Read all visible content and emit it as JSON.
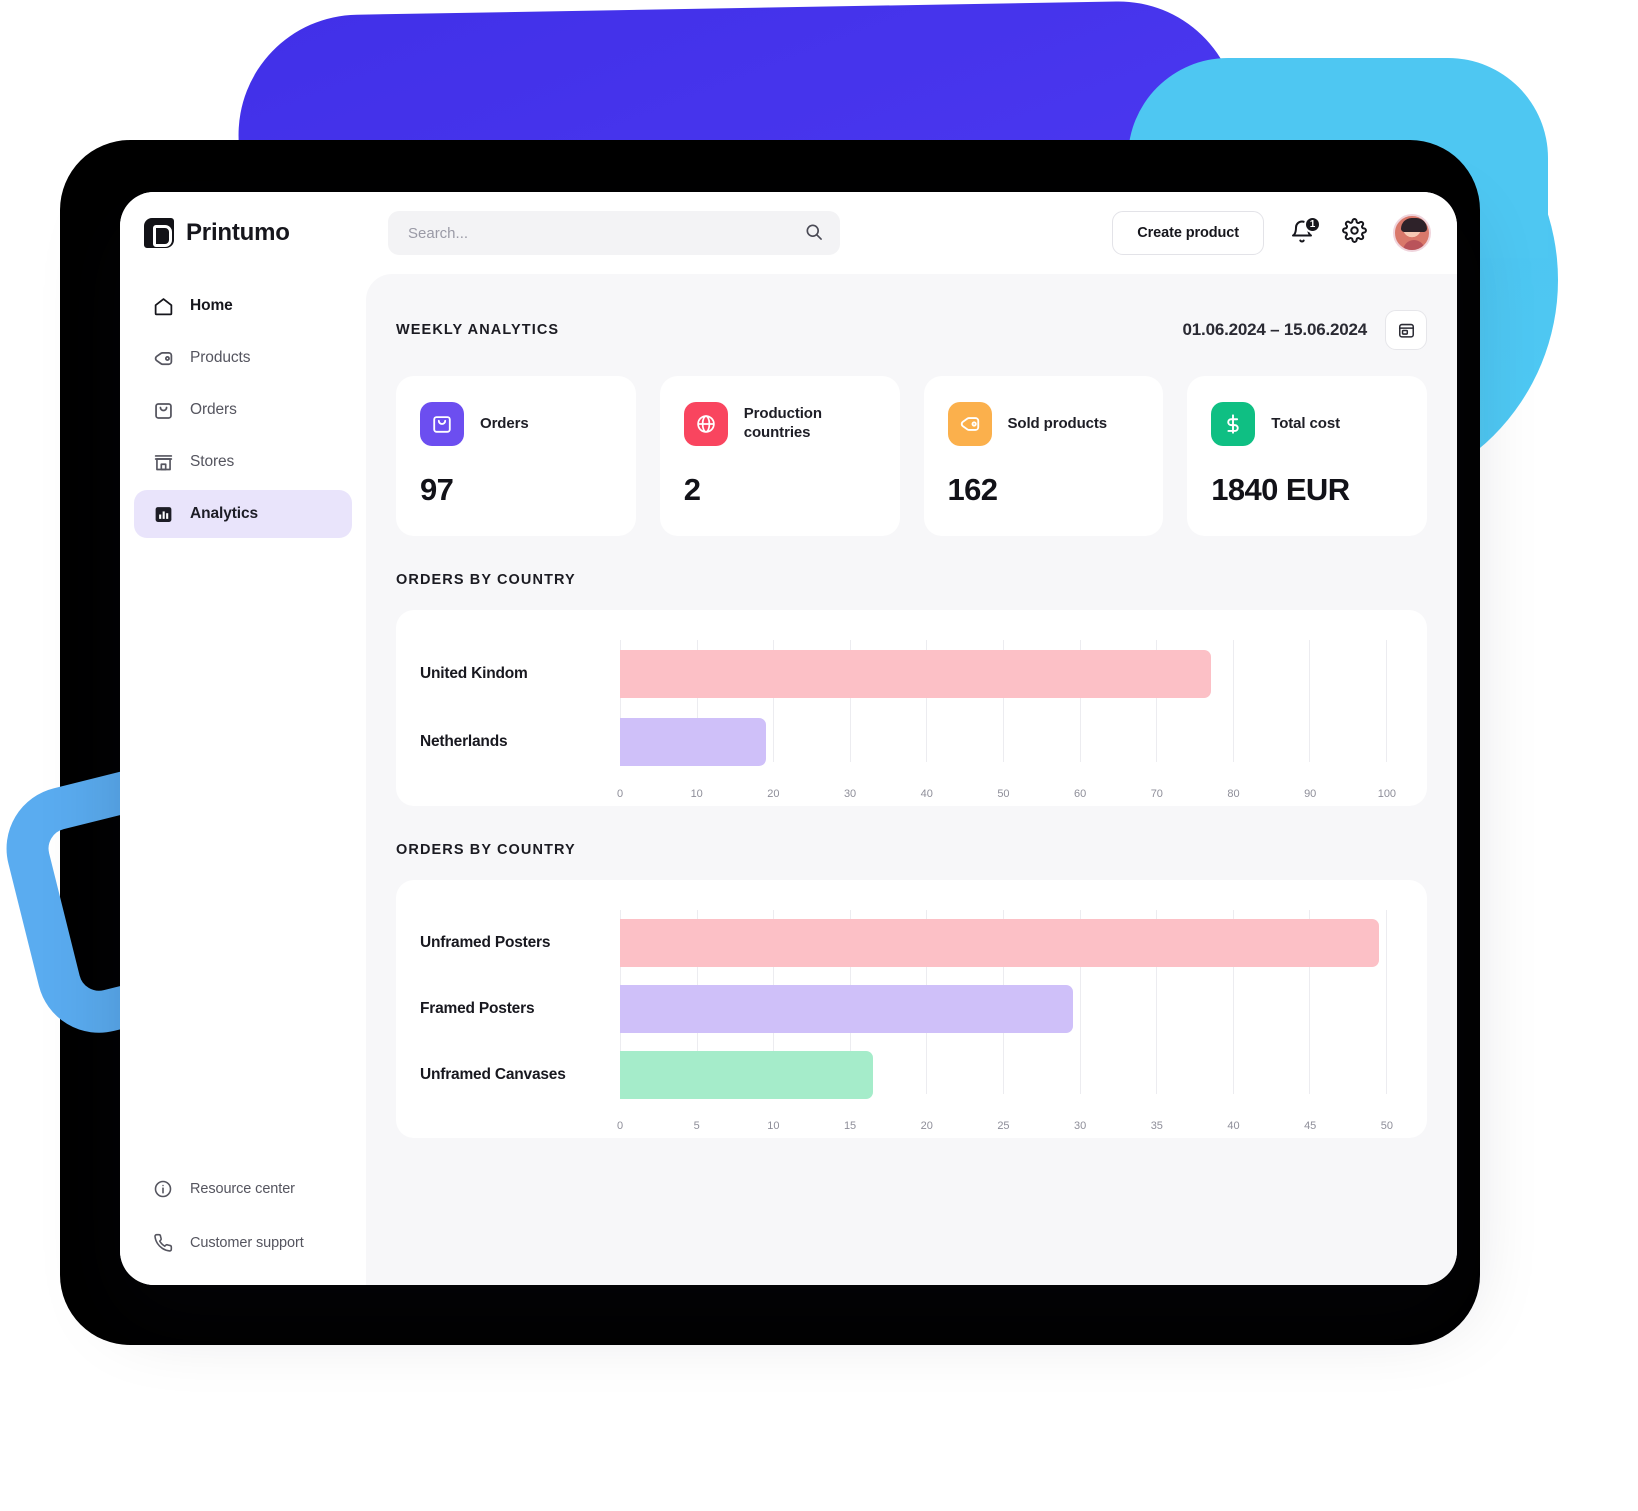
{
  "brand": {
    "name": "Printumo",
    "mark_icon": "printumo-logo-icon"
  },
  "search": {
    "placeholder": "Search...",
    "value": "",
    "icon": "search-icon"
  },
  "header": {
    "create_product_label": "Create product",
    "notification_badge": "1",
    "bell_icon": "bell-icon",
    "gear_icon": "gear-icon",
    "avatar_icon": "user-avatar"
  },
  "sidebar": {
    "items": [
      {
        "label": "Home",
        "icon": "home-icon",
        "active": false,
        "bold": true
      },
      {
        "label": "Products",
        "icon": "tag-icon",
        "active": false
      },
      {
        "label": "Orders",
        "icon": "bag-icon",
        "active": false
      },
      {
        "label": "Stores",
        "icon": "store-icon",
        "active": false
      },
      {
        "label": "Analytics",
        "icon": "bar-chart-icon",
        "active": true
      }
    ],
    "bottom_items": [
      {
        "label": "Resource center",
        "icon": "info-icon"
      },
      {
        "label": "Customer support",
        "icon": "phone-icon"
      }
    ]
  },
  "main": {
    "section_title": "WEEKLY ANALYTICS",
    "date_range": "01.06.2024 – 15.06.2024",
    "calendar_icon": "calendar-icon",
    "stats": [
      {
        "label": "Orders",
        "value": "97",
        "icon": "bag-icon",
        "color": "#6c4ef0"
      },
      {
        "label": "Production countries",
        "value": "2",
        "icon": "globe-icon",
        "color": "#f9455f"
      },
      {
        "label": "Sold products",
        "value": "162",
        "icon": "tag-icon",
        "color": "#fbb04c"
      },
      {
        "label": "Total cost",
        "value": "1840 EUR",
        "icon": "dollar-icon",
        "color": "#0fbf83"
      }
    ]
  },
  "chart_data": [
    {
      "type": "bar",
      "orientation": "horizontal",
      "title": "ORDERS BY COUNTRY",
      "categories": [
        "United Kindom",
        "Netherlands"
      ],
      "values": [
        77,
        19
      ],
      "colors": [
        "#fcc0c6",
        "#cfc0f9"
      ],
      "xlabel": "",
      "ylabel": "",
      "xlim": [
        0,
        100
      ],
      "ticks": [
        "0",
        "10",
        "20",
        "30",
        "40",
        "50",
        "60",
        "70",
        "80",
        "90",
        "100"
      ],
      "grid": true,
      "legend": "none"
    },
    {
      "type": "bar",
      "orientation": "horizontal",
      "title": "ORDERS BY COUNTRY",
      "categories": [
        "Unframed Posters",
        "Framed Posters",
        "Unframed Canvases"
      ],
      "values": [
        49.5,
        29.5,
        16.5
      ],
      "colors": [
        "#fcc0c6",
        "#cfc0f9",
        "#a5ecca"
      ],
      "xlabel": "",
      "ylabel": "",
      "xlim": [
        0,
        50
      ],
      "ticks": [
        "0",
        "5",
        "10",
        "15",
        "20",
        "25",
        "30",
        "35",
        "40",
        "45",
        "50"
      ],
      "grid": true,
      "legend": "none"
    }
  ]
}
